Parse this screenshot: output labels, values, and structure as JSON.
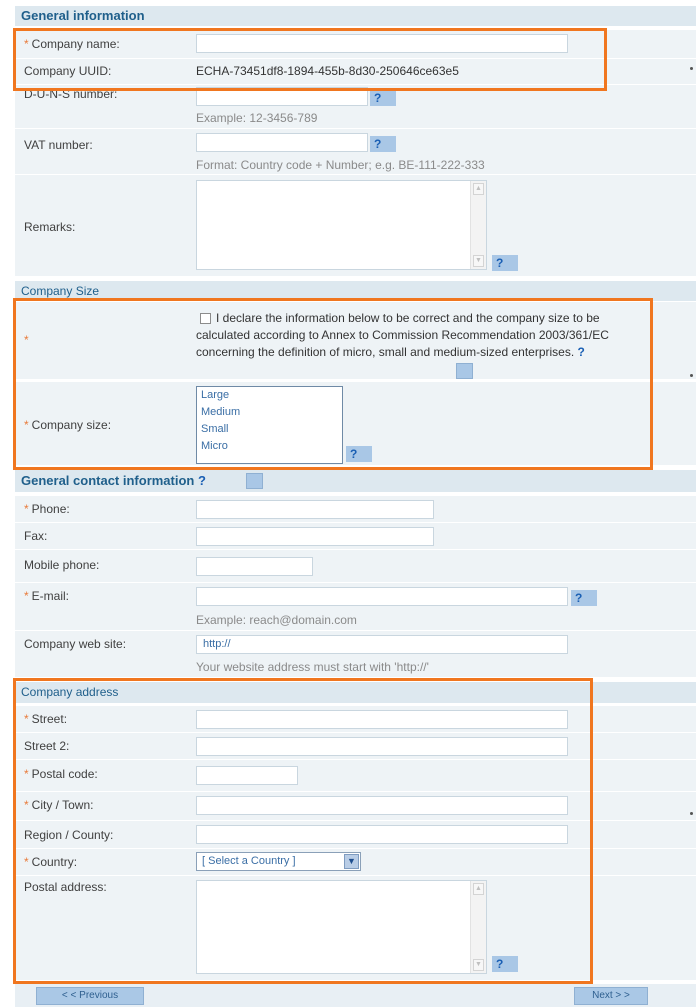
{
  "general": {
    "header": "General information",
    "company_name": {
      "label": "Company name:",
      "value": ""
    },
    "company_uuid": {
      "label": "Company UUID:",
      "value": "ECHA-73451df8-1894-455b-8d30-250646ce63e5"
    },
    "duns": {
      "label": "D-U-N-S number:",
      "value": "",
      "hint": "Example: 12-3456-789"
    },
    "vat": {
      "label": "VAT number:",
      "value": "",
      "hint": "Format: Country code + Number; e.g. BE-111-222-333"
    },
    "remarks": {
      "label": "Remarks:",
      "value": ""
    }
  },
  "company_size": {
    "header": "Company Size",
    "declaration": "I declare the information below to be correct and the company size to be calculated according to Annex to Commission Recommendation 2003/361/EC concerning the definition of micro, small and medium-sized enterprises.",
    "declaration_checked": false,
    "size_label": "Company size:",
    "options": [
      "Large",
      "Medium",
      "Small",
      "Micro"
    ]
  },
  "contact": {
    "header": "General contact information",
    "phone": {
      "label": "Phone:",
      "value": ""
    },
    "fax": {
      "label": "Fax:",
      "value": ""
    },
    "mobile": {
      "label": "Mobile phone:",
      "value": ""
    },
    "email": {
      "label": "E-mail:",
      "value": "",
      "hint": "Example: reach@domain.com"
    },
    "website": {
      "label": "Company web site:",
      "value": "http://",
      "hint": "Your website address must start with 'http://'"
    }
  },
  "address": {
    "header": "Company address",
    "street": {
      "label": "Street:",
      "value": ""
    },
    "street2": {
      "label": "Street 2:",
      "value": ""
    },
    "postal_code": {
      "label": "Postal code:",
      "value": ""
    },
    "city": {
      "label": "City / Town:",
      "value": ""
    },
    "region": {
      "label": "Region / County:",
      "value": ""
    },
    "country": {
      "label": "Country:",
      "selected": "[ Select a Country ]"
    },
    "postal_address": {
      "label": "Postal address:",
      "value": ""
    }
  },
  "common": {
    "help_glyph": "?",
    "required_marker": "*",
    "arrow_up": "▲",
    "arrow_down": "▼",
    "select_arrow": "▼"
  },
  "nav": {
    "previous": "< < Previous",
    "next": "Next > >"
  },
  "colors": {
    "highlight": "#f0761f",
    "header_bg": "#dde8ef",
    "header_text": "#1f5f8b",
    "row_bg": "#eef3f6",
    "required": "#e87a3a",
    "help_bg": "#a9c7e6"
  }
}
